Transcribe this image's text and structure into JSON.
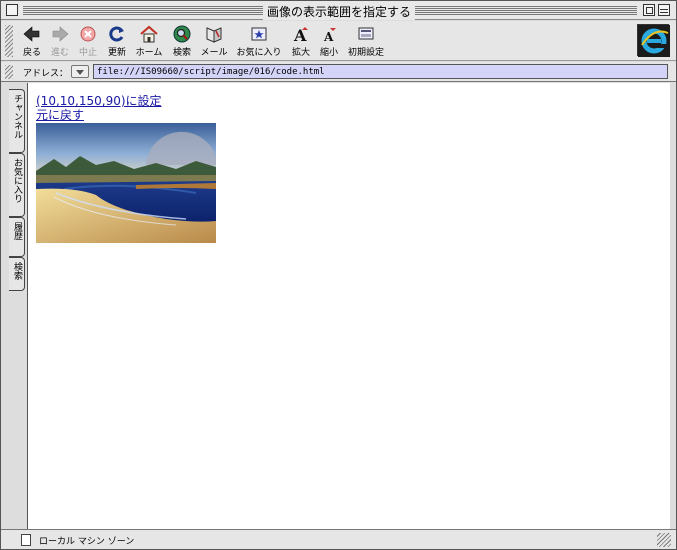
{
  "window": {
    "title": "画像の表示範囲を指定する"
  },
  "toolbar": {
    "items": [
      {
        "label": "戻る",
        "icon": "back-arrow-icon",
        "enabled": true
      },
      {
        "label": "進む",
        "icon": "forward-arrow-icon",
        "enabled": false
      },
      {
        "label": "中止",
        "icon": "stop-icon",
        "enabled": false
      },
      {
        "label": "更新",
        "icon": "refresh-icon",
        "enabled": true
      },
      {
        "label": "ホーム",
        "icon": "home-icon",
        "enabled": true
      },
      {
        "label": "検索",
        "icon": "search-icon",
        "enabled": true
      },
      {
        "label": "メール",
        "icon": "mail-icon",
        "enabled": true
      },
      {
        "label": "お気に入り",
        "icon": "favorites-icon",
        "enabled": true
      },
      {
        "label": "拡大",
        "icon": "text-larger-icon",
        "enabled": true
      },
      {
        "label": "縮小",
        "icon": "text-smaller-icon",
        "enabled": true
      },
      {
        "label": "初期設定",
        "icon": "preferences-icon",
        "enabled": true
      }
    ],
    "logo": "internet-explorer-logo"
  },
  "address": {
    "label": "アドレス：",
    "url": "file:///IS09660/script/image/016/code.html"
  },
  "sidebar": {
    "tabs": [
      "チャンネル",
      "お気に入り",
      "履歴",
      "検索"
    ]
  },
  "content": {
    "link_set": "(10,10,150,90)に設定",
    "link_reset": "元に戻す",
    "image": "beach-landscape-image"
  },
  "status": {
    "text": "ローカル マシン ゾーン"
  },
  "colors": {
    "link": "#1a1aa6",
    "address_bg": "#d4d4f8",
    "chrome": "#e6e6e6"
  }
}
